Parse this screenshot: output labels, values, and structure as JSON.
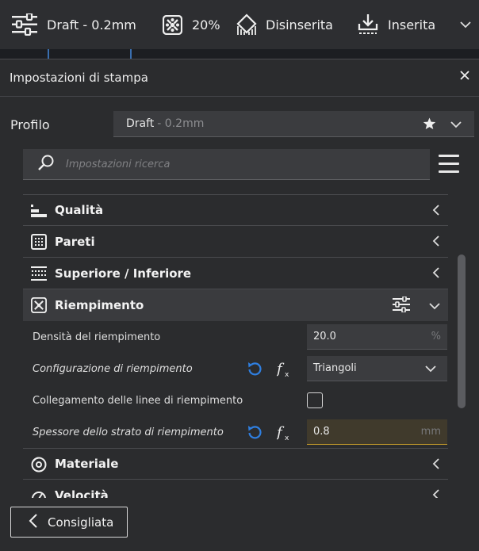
{
  "topbar": {
    "profile_label": "Draft - 0.2mm",
    "infill_label": "20%",
    "support_label": "Disinserita",
    "adhesion_label": "Inserita",
    "icons": [
      "settings-sliders-icon",
      "infill-icon",
      "support-icon",
      "adhesion-icon",
      "chevron-down-icon"
    ]
  },
  "panel": {
    "title": "Impostazioni di stampa",
    "profile": {
      "label": "Profilo",
      "name": "Draft",
      "sub": "- 0.2mm"
    },
    "search": {
      "placeholder": "Impostazioni ricerca"
    },
    "categories": [
      {
        "label": "Qualità",
        "icon": "quality-icon",
        "expanded": false
      },
      {
        "label": "Pareti",
        "icon": "walls-icon",
        "expanded": false
      },
      {
        "label": "Superiore / Inferiore",
        "icon": "top-bottom-icon",
        "expanded": false
      },
      {
        "label": "Riempimento",
        "icon": "infill-icon",
        "expanded": true
      },
      {
        "label": "Materiale",
        "icon": "material-icon",
        "expanded": false
      },
      {
        "label": "Velocità",
        "icon": "speed-icon",
        "expanded": false
      }
    ],
    "infill_settings": {
      "density": {
        "label": "Densità del riempimento",
        "value": "20.0",
        "unit": "%"
      },
      "pattern": {
        "label": "Configurazione di riempimento",
        "value": "Triangoli"
      },
      "connect_lines": {
        "label": "Collegamento delle linee di riempimento",
        "checked": false
      },
      "layer_thickness": {
        "label": "Spessore dello strato di riempimento",
        "value": "0.8",
        "unit": "mm"
      }
    },
    "recommended_button": "Consigliata"
  },
  "colors": {
    "background": "#2b2c2e",
    "field": "#3b3c3f",
    "accent_blue": "#2f7fe0",
    "warning_border": "#c49a2a"
  }
}
